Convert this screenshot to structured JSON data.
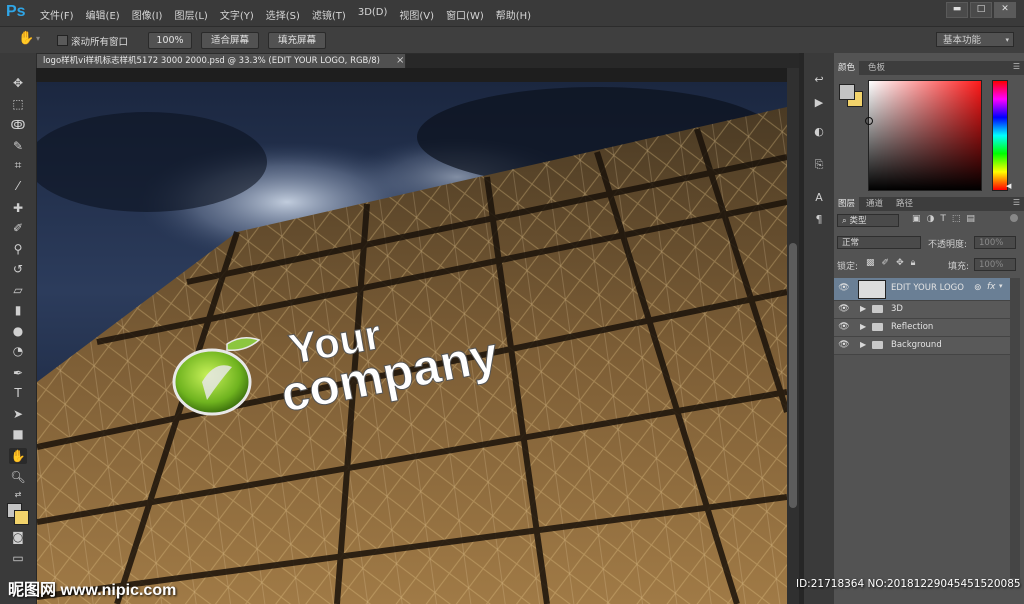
{
  "app": {
    "logo": "Ps"
  },
  "menu": [
    "文件(F)",
    "编辑(E)",
    "图像(I)",
    "图层(L)",
    "文字(Y)",
    "选择(S)",
    "滤镜(T)",
    "3D(D)",
    "视图(V)",
    "窗口(W)",
    "帮助(H)"
  ],
  "window_controls": {
    "minimize": "▬",
    "restore": "□",
    "close": "✕"
  },
  "options": {
    "scroll_all_label": "滚动所有窗口",
    "zoom_100": "100%",
    "fit_screen": "适合屏幕",
    "fill_screen": "填充屏幕",
    "workspace": "基本功能"
  },
  "document": {
    "tab_title": "logo样机vi样机标志样机5172 3000 2000.psd @ 33.3% (EDIT YOUR LOGO, RGB/8)",
    "tab_close": "×",
    "logo_line1": "Your",
    "logo_line2": "company"
  },
  "panels": {
    "color_tabs": [
      "颜色",
      "色板"
    ],
    "layers_tabs": [
      "图层",
      "通道",
      "路径"
    ],
    "filter_kind": "类型",
    "blend_mode": "正常",
    "opacity_label": "不透明度:",
    "opacity_value": "100%",
    "lock_label": "锁定:",
    "fill_label": "填充:",
    "fill_value": "100%",
    "layers": [
      {
        "name": "EDIT YOUR LOGO",
        "type": "smart",
        "selected": true,
        "fx": "fx"
      },
      {
        "name": "3D",
        "type": "group"
      },
      {
        "name": "Reflection",
        "type": "group"
      },
      {
        "name": "Background",
        "type": "group"
      }
    ]
  },
  "watermark": {
    "left": "昵图网 www.nipic.com",
    "right": "ID:21718364 NO:20181229045451520085"
  },
  "colors": {
    "foreground": "#c4c4c4",
    "background": "#f2d36b",
    "accent": "#2fa5e6",
    "selected_layer": "#6a7f95"
  }
}
